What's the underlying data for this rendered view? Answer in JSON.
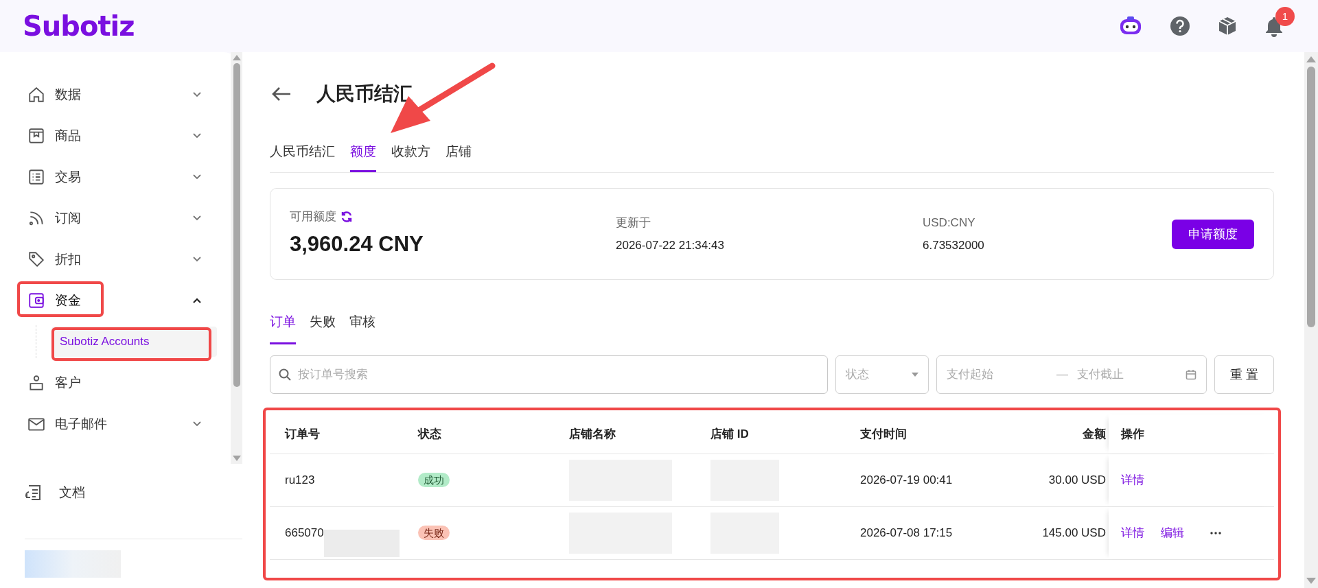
{
  "header": {
    "logo": "Subotiz",
    "notification_count": "1"
  },
  "sidebar": {
    "items": [
      {
        "label": "数据",
        "expandable": true,
        "expanded": false,
        "selected": false
      },
      {
        "label": "商品",
        "expandable": true,
        "expanded": false,
        "selected": false
      },
      {
        "label": "交易",
        "expandable": true,
        "expanded": false,
        "selected": false
      },
      {
        "label": "订阅",
        "expandable": true,
        "expanded": false,
        "selected": false
      },
      {
        "label": "折扣",
        "expandable": true,
        "expanded": false,
        "selected": false
      },
      {
        "label": "资金",
        "expandable": true,
        "expanded": true,
        "selected": true,
        "children": [
          {
            "label": "Subotiz Accounts",
            "selected": true
          }
        ]
      },
      {
        "label": "客户",
        "expandable": false,
        "expanded": false,
        "selected": false
      },
      {
        "label": "电子邮件",
        "expandable": true,
        "expanded": false,
        "selected": false
      }
    ],
    "footer_item": {
      "label": "文档"
    }
  },
  "page": {
    "title": "人民币结汇",
    "tabs": [
      {
        "label": "人民币结汇",
        "selected": false
      },
      {
        "label": "额度",
        "selected": true
      },
      {
        "label": "收款方",
        "selected": false
      },
      {
        "label": "店铺",
        "selected": false
      }
    ],
    "summary": {
      "available_label": "可用额度",
      "available_value": "3,960.24 CNY",
      "updated_label": "更新于",
      "updated_value": "2026-07-22 21:34:43",
      "rate_label": "USD:CNY",
      "rate_value": "6.73532000",
      "apply_button": "申请额度"
    },
    "subtabs": [
      {
        "label": "订单",
        "selected": true
      },
      {
        "label": "失败",
        "selected": false
      },
      {
        "label": "审核",
        "selected": false
      }
    ],
    "filters": {
      "search_placeholder": "按订单号搜索",
      "status_placeholder": "状态",
      "date_start_placeholder": "支付起始",
      "date_separator": "—",
      "date_end_placeholder": "支付截止",
      "reset_button": "重 置"
    },
    "table": {
      "columns": [
        "订单号",
        "状态",
        "店铺名称",
        "店铺 ID",
        "支付时间",
        "金额",
        "操作"
      ],
      "rows": [
        {
          "order_no": "ru123",
          "order_redacted": false,
          "status": "成功",
          "kind": "success",
          "payment_time": "2026-07-19 00:41",
          "amount": "30.00 USD",
          "actions": [
            "详情"
          ],
          "more": false
        },
        {
          "order_no": "665070",
          "order_redacted": true,
          "status": "失败",
          "kind": "failed",
          "payment_time": "2026-07-08 17:15",
          "amount": "145.00 USD",
          "actions": [
            "详情",
            "编辑"
          ],
          "more": true
        }
      ]
    }
  }
}
